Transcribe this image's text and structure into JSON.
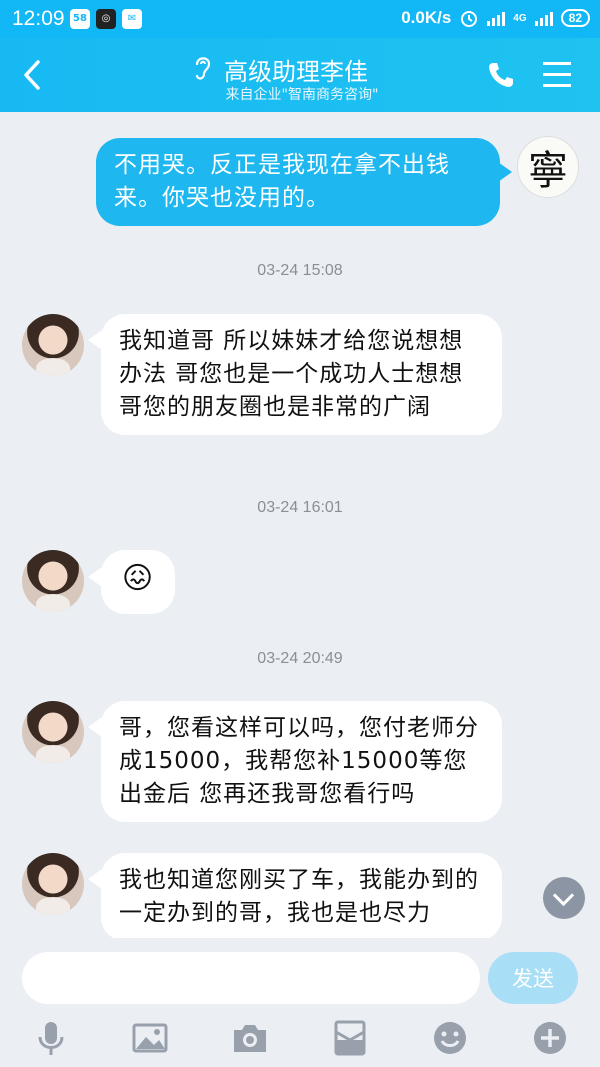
{
  "status_bar": {
    "time": "12:09",
    "network_speed": "0.0K/s",
    "network_type": "4G",
    "battery": "82",
    "app_icons": [
      "58",
      "app",
      "wechat"
    ]
  },
  "header": {
    "title": "高级助理李佳",
    "subtitle": "来自企业\"智南商务咨询\"",
    "icons": [
      "back-arrow-icon",
      "ear-icon",
      "phone-icon",
      "menu-icon"
    ]
  },
  "messages": [
    {
      "sender": "me",
      "avatar_char": "寧",
      "text": "不用哭。反正是我现在拿不出钱来。你哭也没用的。"
    },
    {
      "type": "timestamp",
      "text": "03-24 15:08"
    },
    {
      "sender": "other",
      "text": "我知道哥 所以妹妹才给您说想想办法  哥您也是一个成功人士想想哥您的朋友圈也是非常的广阔"
    },
    {
      "type": "timestamp",
      "text": "03-24 16:01"
    },
    {
      "sender": "other",
      "emoji": "😖"
    },
    {
      "type": "timestamp",
      "text": "03-24 20:49"
    },
    {
      "sender": "other",
      "text": "哥，您看这样可以吗，您付老师分成15000，我帮您补15000等您出金后 您再还我哥您看行吗"
    },
    {
      "sender": "other",
      "text": "我也知道您刚买了车，我能办到的一定办到的哥，我也是也尽力"
    }
  ],
  "composer": {
    "input_value": "",
    "send_label": "发送",
    "tools": [
      "microphone-icon",
      "image-icon",
      "camera-icon",
      "red-packet-icon",
      "emoji-icon",
      "plus-icon"
    ]
  },
  "colors": {
    "accent": "#12b7f5",
    "outgoing_bubble": "#1eb7ef",
    "send_button": "#a8def6",
    "background": "#ebeef3"
  }
}
